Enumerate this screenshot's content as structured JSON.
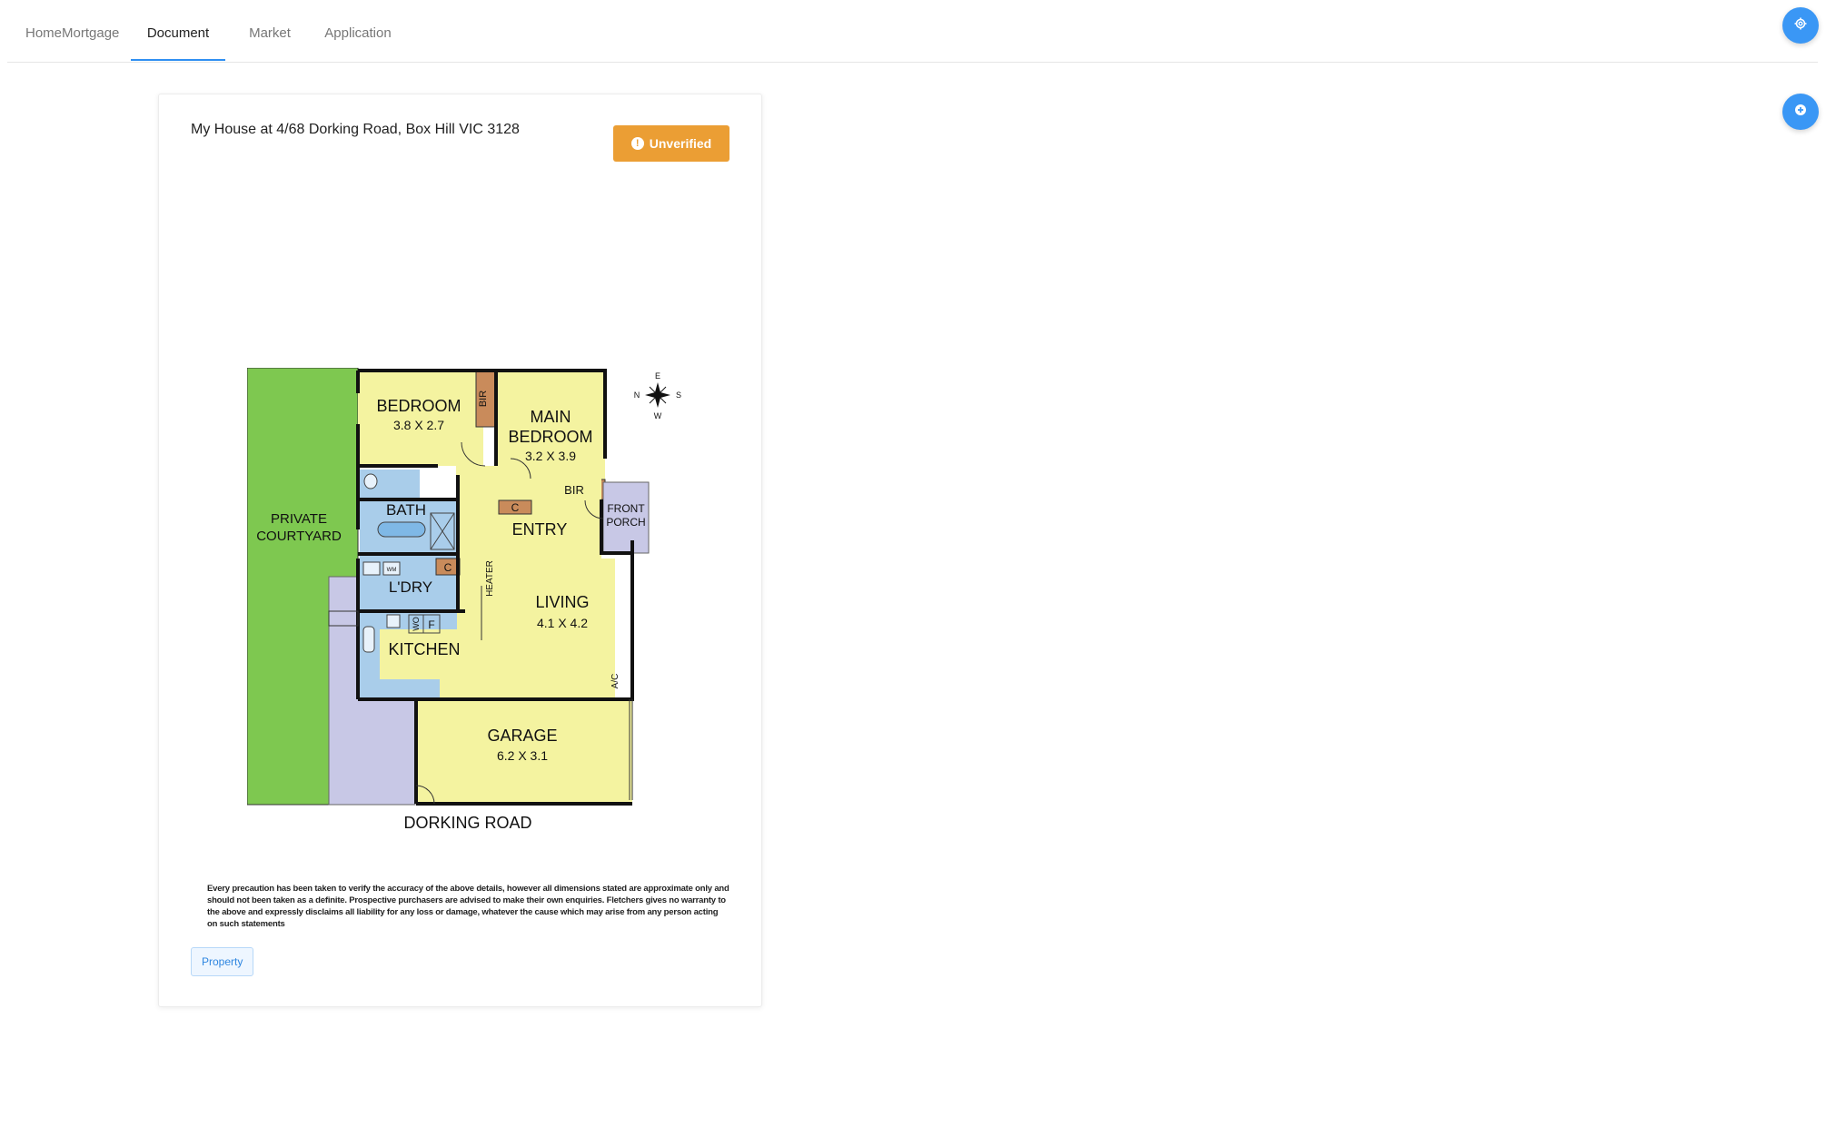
{
  "nav": {
    "tabs": [
      {
        "label": "HomeMortgage"
      },
      {
        "label": "Document"
      },
      {
        "label": "Market"
      },
      {
        "label": "Application"
      }
    ],
    "active_tab": "Document"
  },
  "fab_buttons": {
    "settings_icon": "gear-icon",
    "add_icon": "plus-icon"
  },
  "document": {
    "title": "My House at 4/68 Dorking Road, Box Hill VIC 3128",
    "status": "Unverified",
    "status_icon": "alert-icon",
    "status_color": "#eb9e34",
    "tag": "Property",
    "floorplan": {
      "rooms": [
        {
          "name": "BEDROOM",
          "size": "3.8 X 2.7"
        },
        {
          "name": "MAIN",
          "name2": "BEDROOM",
          "size": "3.2 X 3.9"
        },
        {
          "name": "BIR"
        },
        {
          "name": "BIR"
        },
        {
          "name": "PRIVATE",
          "name2": "COURTYARD"
        },
        {
          "name": "BATH"
        },
        {
          "name": "C"
        },
        {
          "name": "ENTRY"
        },
        {
          "name": "FRONT",
          "name2": "PORCH"
        },
        {
          "name": "C"
        },
        {
          "name": "L'DRY"
        },
        {
          "name": "WM"
        },
        {
          "name": "HEATER"
        },
        {
          "name": "LIVING",
          "size": "4.1 X 4.2"
        },
        {
          "name": "WO"
        },
        {
          "name": "F"
        },
        {
          "name": "KITCHEN"
        },
        {
          "name": "A/C"
        },
        {
          "name": "GARAGE",
          "size": "6.2 X 3.1"
        }
      ],
      "street": "DORKING ROAD",
      "compass": {
        "n": "N",
        "e": "E",
        "s": "S",
        "w": "W"
      }
    },
    "disclaimer": "Every precaution has been taken to verify the accuracy of the above details, however all dimensions stated are approximate only and should not been taken as a definite. Prospective purchasers are advised to make their own enquiries. Fletchers gives no warranty to the above and expressly disclaims all liability for any loss or damage, whatever the cause which may arise from any person acting on such statements"
  }
}
